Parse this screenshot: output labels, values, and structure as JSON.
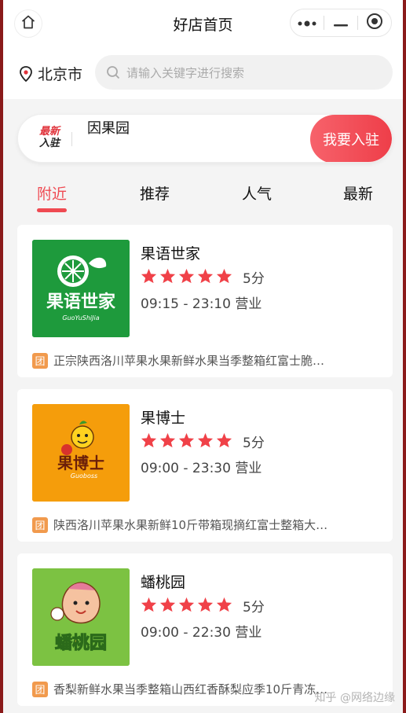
{
  "navbar": {
    "title": "好店首页",
    "home_icon": "home-icon",
    "more_icon": "more-dots-icon",
    "minimize_icon": "minimize-icon",
    "close_icon": "target-circle-icon"
  },
  "location": {
    "city": "北京市",
    "icon": "location-pin-icon"
  },
  "search": {
    "placeholder": "请输入关键字进行搜索",
    "icon": "search-icon"
  },
  "join_banner": {
    "badge_line1": "最新",
    "badge_line2": "入驻",
    "shop": "因果园",
    "button": "我要入驻"
  },
  "tabs": [
    {
      "label": "附近",
      "active": true
    },
    {
      "label": "推荐",
      "active": false
    },
    {
      "label": "人气",
      "active": false
    },
    {
      "label": "最新",
      "active": false
    }
  ],
  "shops": [
    {
      "name": "果语世家",
      "rating": 5,
      "score": "5分",
      "hours": "09:15 - 23:10 营业",
      "deal_tag": "团",
      "deal": "正宗陕西洛川苹果水果新鲜水果当季整箱红富士脆…",
      "logo_text": "果语世家",
      "logo_sub": "GuoYuShiJia",
      "logo_bg": "#1e9a3c"
    },
    {
      "name": "果博士",
      "rating": 5,
      "score": "5分",
      "hours": "09:00 - 23:30 营业",
      "deal_tag": "团",
      "deal": "陕西洛川苹果水果新鲜10斤带箱现摘红富士整箱大…",
      "logo_text": "果博士",
      "logo_sub": "Guoboss",
      "logo_bg": "#f59d0b"
    },
    {
      "name": "蟠桃园",
      "rating": 5,
      "score": "5分",
      "hours": "09:00 - 22:30 营业",
      "deal_tag": "团",
      "deal": "香梨新鲜水果当季整箱山西红香酥梨应季10斤青冻…",
      "logo_text": "蟠桃园",
      "logo_bg": "#7cc242"
    }
  ],
  "watermark": "知乎 @网络边缘",
  "colors": {
    "accent": "#ef4a52",
    "star": "#f04148",
    "deal_tag": "#f19a4d"
  }
}
